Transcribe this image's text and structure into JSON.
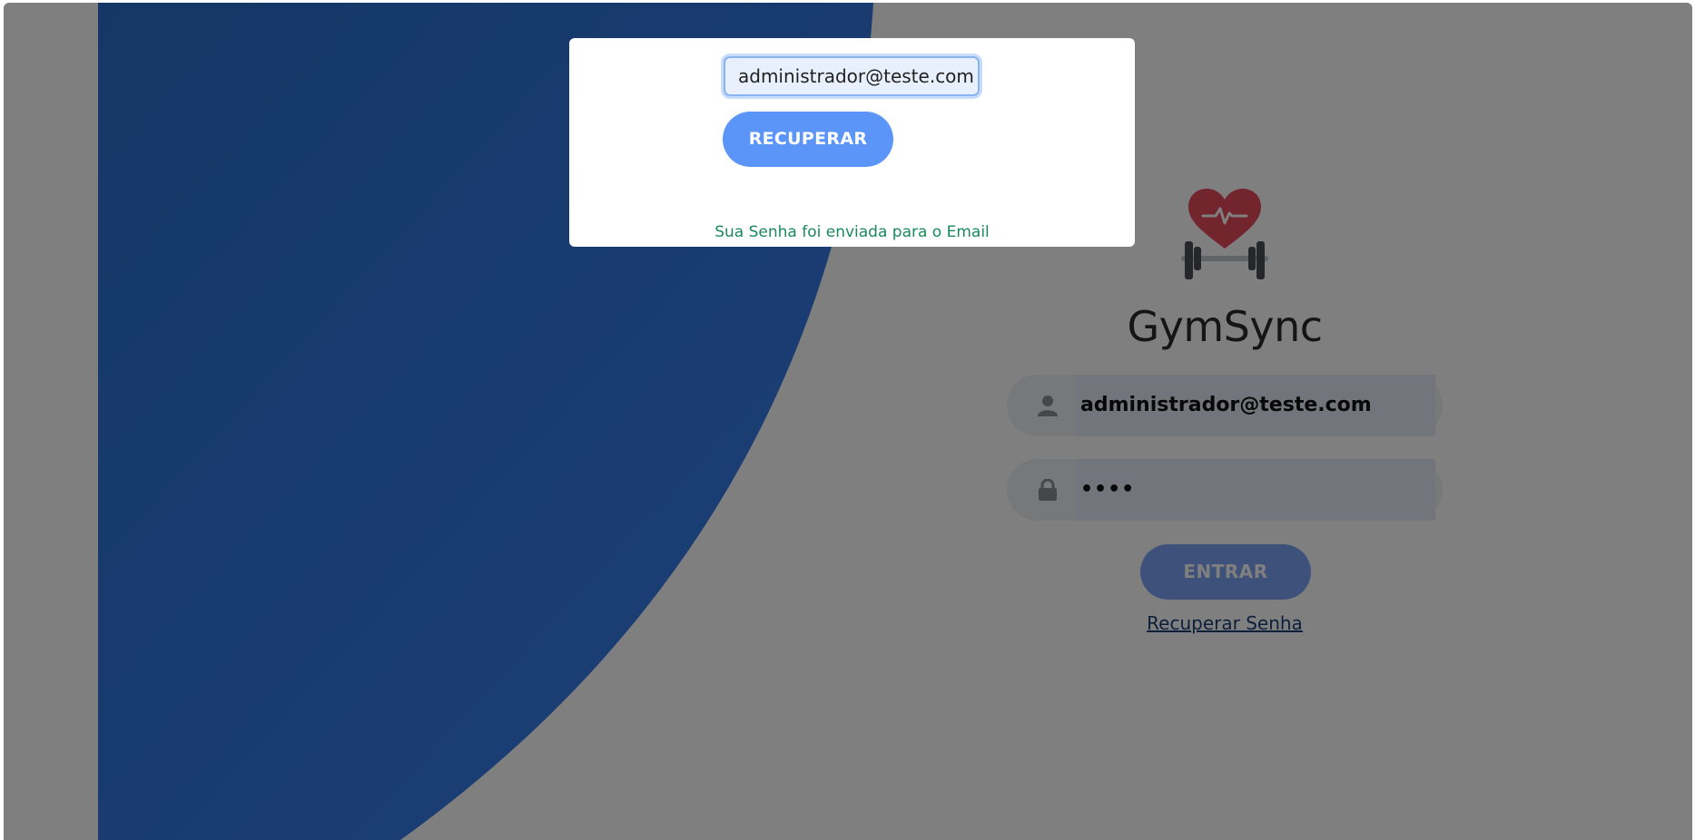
{
  "app": {
    "title": "GymSync"
  },
  "login": {
    "email_value": "administrador@teste.com",
    "password_masked": "••••",
    "submit_label": "ENTRAR",
    "recover_link": "Recuperar Senha"
  },
  "recovery_modal": {
    "email_value": "administrador@teste.com",
    "submit_label": "RECUPERAR",
    "success_message": "Sua Senha foi enviada para o Email"
  },
  "icons": {
    "logo": "heart-dumbbell-logo-icon",
    "user": "user-icon",
    "lock": "lock-icon"
  },
  "colors": {
    "brand_blue": "#2769cc",
    "button_blue": "#5b95f8",
    "link_blue": "#1c3e78",
    "heart_red": "#e64a5c",
    "success_green": "#1a8a5c"
  }
}
